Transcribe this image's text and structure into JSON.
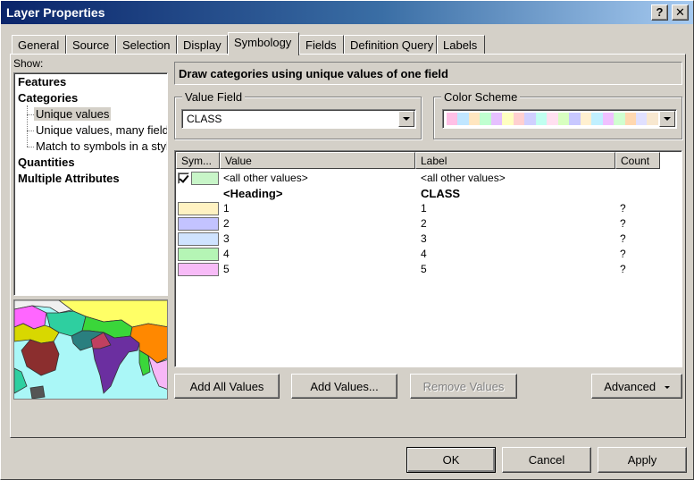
{
  "window": {
    "title": "Layer Properties",
    "help_glyph": "?",
    "close_glyph": "✕"
  },
  "tabs": [
    "General",
    "Source",
    "Selection",
    "Display",
    "Symbology",
    "Fields",
    "Definition Query",
    "Labels"
  ],
  "active_tab": "Symbology",
  "show": {
    "label": "Show:",
    "items": [
      {
        "label": "Features",
        "bold": true
      },
      {
        "label": "Categories",
        "bold": true
      },
      {
        "label": "Unique values",
        "bold": false,
        "selected": true
      },
      {
        "label": "Unique values, many fields",
        "bold": false
      },
      {
        "label": "Match to symbols in a style",
        "bold": false
      },
      {
        "label": "Quantities",
        "bold": true
      },
      {
        "label": "Multiple Attributes",
        "bold": true
      }
    ]
  },
  "description": "Draw categories using unique values of one field",
  "value_field": {
    "legend": "Value Field",
    "value": "CLASS"
  },
  "color_scheme": {
    "legend": "Color Scheme",
    "colors": [
      "#ffc0e6",
      "#c0e6ff",
      "#ffe6c0",
      "#c0ffd0",
      "#e6c0ff",
      "#ffffc0",
      "#ffd0d0",
      "#d0d0ff",
      "#c0fff0",
      "#ffe0f0",
      "#d8ffc0",
      "#c8c8ff",
      "#fff0d0",
      "#c0f0ff",
      "#f0c0ff",
      "#d0ffd0",
      "#ffd8b0",
      "#e0e0ff",
      "#f8e8d0"
    ]
  },
  "grid": {
    "columns": [
      "Sym...",
      "Value",
      "Label",
      "Count"
    ],
    "other_row": {
      "value": "<all other values>",
      "label": "<all other values>",
      "color": "#c8f5c8",
      "checked": true
    },
    "heading_row": {
      "value": "<Heading>",
      "label": "CLASS"
    },
    "rows": [
      {
        "value": "1",
        "label": "1",
        "count": "?",
        "color": "#fff2c2"
      },
      {
        "value": "2",
        "label": "2",
        "count": "?",
        "color": "#c3c3ff"
      },
      {
        "value": "3",
        "label": "3",
        "count": "?",
        "color": "#cfe3ff"
      },
      {
        "value": "4",
        "label": "4",
        "count": "?",
        "color": "#b5f5b5"
      },
      {
        "value": "5",
        "label": "5",
        "count": "?",
        "color": "#f7bbf7"
      }
    ]
  },
  "buttons": {
    "add_all": "Add All Values",
    "add_values": "Add Values...",
    "remove_values": "Remove Values",
    "advanced": "Advanced"
  },
  "footer": {
    "ok": "OK",
    "cancel": "Cancel",
    "apply": "Apply"
  }
}
